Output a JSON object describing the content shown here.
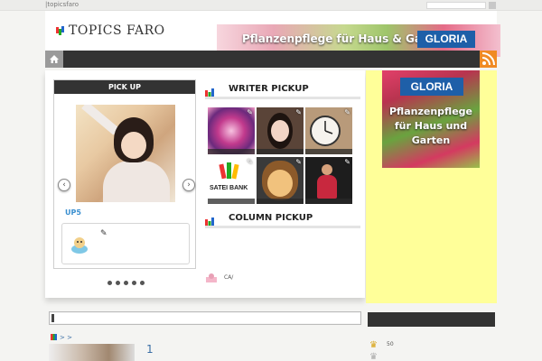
{
  "topbar": {
    "site_name": "|topicsfaro"
  },
  "header": {
    "logo_text": "TOPICS FARO",
    "banner": {
      "text": "Pflanzenpflege für Haus & Garten",
      "brand": "GLORIA"
    }
  },
  "nav": {
    "home_icon": "home-icon",
    "rss_icon": "rss-icon"
  },
  "pickup": {
    "title": "PICK UP",
    "label": "UP5",
    "prev_glyph": "‹",
    "next_glyph": "›",
    "pen_glyph": "✎",
    "dots_count": 5
  },
  "writer_pickup": {
    "title": "WRITER PICKUP",
    "tiles": [
      {
        "name": "kaleidoscope"
      },
      {
        "name": "woman-portrait"
      },
      {
        "name": "clock"
      },
      {
        "name": "satei-bank",
        "text": "SATEI BANK"
      },
      {
        "name": "illustrated-face"
      },
      {
        "name": "performer"
      }
    ]
  },
  "column_pickup": {
    "title": "COLUMN PICKUP",
    "items": [
      {
        "text": "CA/"
      }
    ]
  },
  "sidebar": {
    "ad": {
      "brand": "GLORIA",
      "text": "Pflanzenpflege für Haus und Garten"
    },
    "ranking": [
      {
        "count": "50"
      }
    ]
  },
  "content": {
    "breadcrumb": "> >",
    "list_number": "1"
  },
  "colors": {
    "nav_bg": "#333333",
    "sidebar_bg": "#ffff99",
    "accent_link": "#3a8fd0",
    "rss": "#f08a24",
    "gloria_blue": "#1e5fa8"
  }
}
